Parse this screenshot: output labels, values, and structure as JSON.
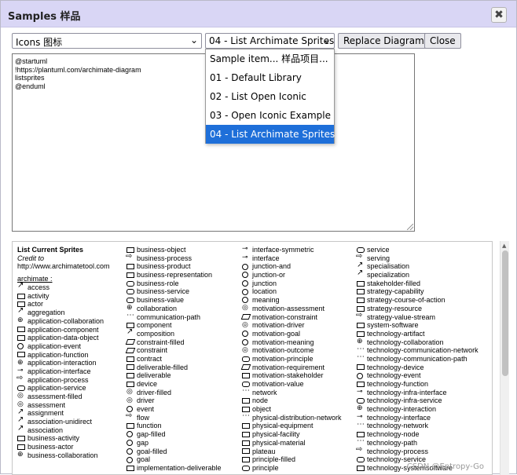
{
  "dialog": {
    "title": "Samples 样品",
    "close_glyph": "✖"
  },
  "toolbar": {
    "library_select": "Icons 图标",
    "sample_select": "04 - List Archimate Sprites",
    "chevron": "⌄",
    "replace_label": "Replace Diagram",
    "close_label": "Close"
  },
  "dropdown": {
    "items": [
      "Sample item... 样品项目...",
      "01 - Default Library",
      "02 - List Open Iconic",
      "03 - Open Iconic Example",
      "04 - List Archimate Sprites"
    ]
  },
  "editor": {
    "lines": [
      "@startuml",
      "!https://plantuml.com/archimate-diagram",
      "listsprites",
      "@enduml"
    ]
  },
  "preview": {
    "heading": "List Current Sprites",
    "credit": "Credit to",
    "credit_url": "http://www.archimatetool.com",
    "group": "archimate",
    "group_suffix": " :",
    "col1": [
      "access",
      "activity",
      "actor",
      "aggregation",
      "application-collaboration",
      "application-component",
      "application-data-object",
      "application-event",
      "application-function",
      "application-interaction",
      "application-interface",
      "application-process",
      "application-service",
      "assessment-filled",
      "assessment",
      "assignment",
      "association-unidirect",
      "association",
      "business-activity",
      "business-actor",
      "business-collaboration"
    ],
    "col2": [
      "business-object",
      "business-process",
      "business-product",
      "business-representation",
      "business-role",
      "business-service",
      "business-value",
      "collaboration",
      "communication-path",
      "component",
      "composition",
      "constraint-filled",
      "constraint",
      "contract",
      "deliverable-filled",
      "deliverable",
      "device",
      "driver-filled",
      "driver",
      "event",
      "flow",
      "function",
      "gap-filled",
      "gap",
      "goal-filled",
      "goal",
      "implementation-deliverable"
    ],
    "col3": [
      "interface-symmetric",
      "interface",
      "junction-and",
      "junction-or",
      "junction",
      "location",
      "meaning",
      "motivation-assessment",
      "motivation-constraint",
      "motivation-driver",
      "motivation-goal",
      "motivation-meaning",
      "motivation-outcome",
      "motivation-principle",
      "motivation-requirement",
      "motivation-stakeholder",
      "motivation-value",
      "network",
      "node",
      "object",
      "physical-distribution-network",
      "physical-equipment",
      "physical-facility",
      "physical-material",
      "plateau",
      "principle-filled",
      "principle"
    ],
    "col4": [
      "service",
      "serving",
      "specialisation",
      "specialization",
      "stakeholder-filled",
      "strategy-capability",
      "strategy-course-of-action",
      "strategy-resource",
      "strategy-value-stream",
      "system-software",
      "technology-artifact",
      "technology-collaboration",
      "technology-communication-network",
      "technology-communication-path",
      "technology-device",
      "technology-event",
      "technology-function",
      "technology-infra-interface",
      "technology-infra-service",
      "technology-interaction",
      "technology-interface",
      "technology-network",
      "technology-node",
      "technology-path",
      "technology-process",
      "technology-service",
      "technology-systemsoftware"
    ]
  },
  "watermark": "CSDN @Entropy-Go",
  "colors": {
    "titlebar": "#d9d6f5",
    "selected": "#1e6fd9"
  }
}
